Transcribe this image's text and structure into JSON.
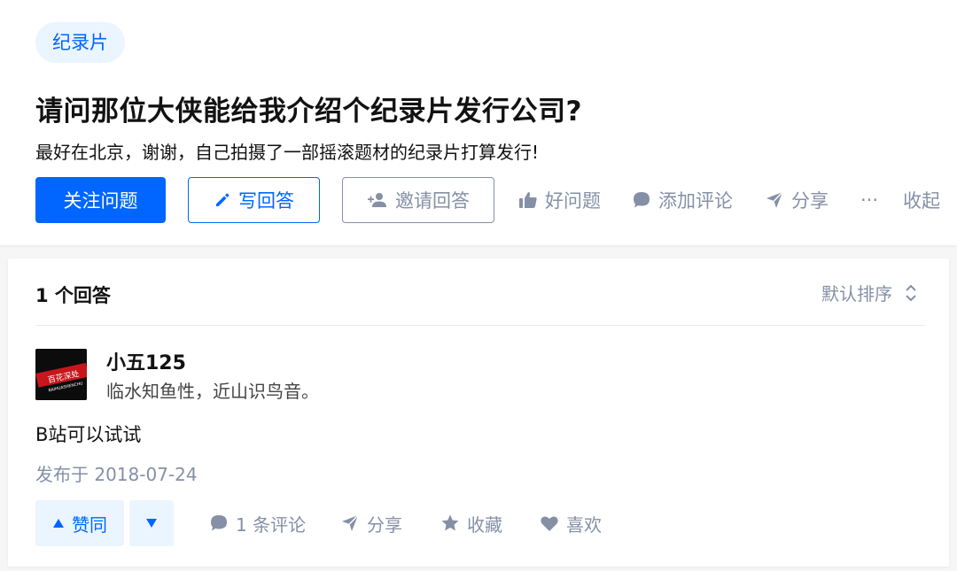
{
  "question": {
    "topic_tag": "纪录片",
    "title": "请问那位大侠能给我介绍个纪录片发行公司?",
    "detail": "最好在北京，谢谢，自己拍摄了一部摇滚题材的纪录片打算发行!"
  },
  "question_actions": {
    "follow_label": "关注问题",
    "write_label": "写回答",
    "invite_label": "邀请回答",
    "good_question_label": "好问题",
    "comment_label": "添加评论",
    "share_label": "分享",
    "more_label": "···",
    "collapse_label": "收起"
  },
  "answers_header": {
    "count_label": "1 个回答",
    "sort_label": "默认排序"
  },
  "answer": {
    "author": {
      "name": "小五125",
      "bio": "临水知鱼性，近山识鸟音。",
      "avatar_text": "百花深处",
      "avatar_subtext": "BAIHUASHENCHU"
    },
    "content": "B站可以试试",
    "published": "发布于 2018-07-24",
    "actions": {
      "upvote_label": "赞同",
      "comments_label": "1 条评论",
      "share_label": "分享",
      "favorite_label": "收藏",
      "like_label": "喜欢"
    }
  },
  "colors": {
    "brand_blue": "#0066ff",
    "tag_bg": "#ebf5ff",
    "muted_gray": "#8590a6",
    "page_bg": "#f6f6f6"
  },
  "icons": [
    "pencil-icon",
    "add-person-icon",
    "thumb-up-icon",
    "comment-bubble-icon",
    "paper-plane-icon",
    "sort-chevrons-icon",
    "triangle-up-icon",
    "triangle-down-icon",
    "star-icon",
    "heart-icon"
  ]
}
